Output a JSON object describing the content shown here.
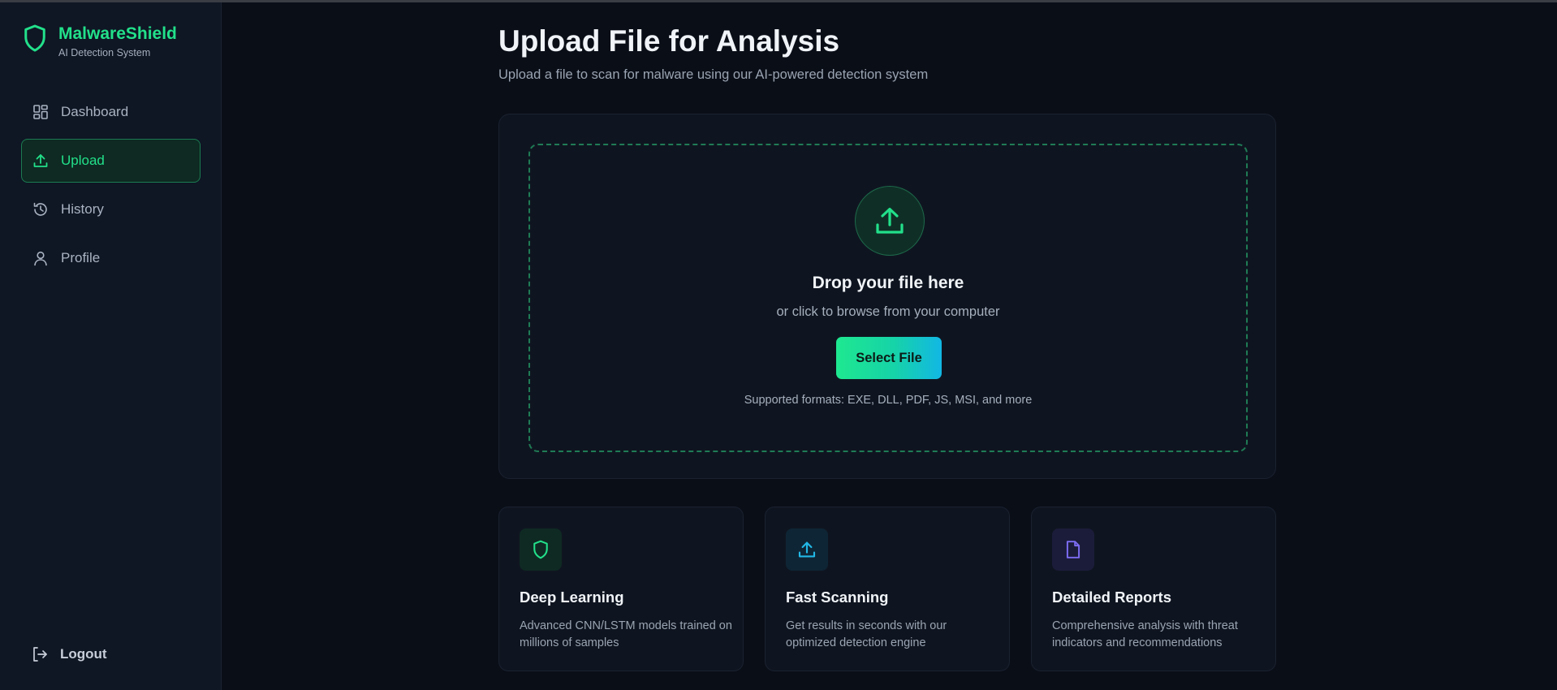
{
  "brand": {
    "title": "MalwareShield",
    "subtitle": "AI Detection System",
    "icon": "shield-icon"
  },
  "nav": {
    "items": [
      {
        "label": "Dashboard",
        "icon": "dashboard-icon",
        "active": false
      },
      {
        "label": "Upload",
        "icon": "upload-icon",
        "active": true
      },
      {
        "label": "History",
        "icon": "history-icon",
        "active": false
      },
      {
        "label": "Profile",
        "icon": "user-icon",
        "active": false
      }
    ],
    "logout": "Logout"
  },
  "page": {
    "title": "Upload File for Analysis",
    "subtitle": "Upload a file to scan for malware using our AI-powered detection system"
  },
  "dropzone": {
    "title": "Drop your file here",
    "subtitle": "or click to browse from your computer",
    "button": "Select File",
    "formats": "Supported formats: EXE, DLL, PDF, JS, MSI, and more"
  },
  "features": [
    {
      "title": "Deep Learning",
      "description": "Advanced CNN/LSTM models trained on millions of samples",
      "icon": "shield-icon",
      "color": "#22e08a"
    },
    {
      "title": "Fast Scanning",
      "description": "Get results in seconds with our optimized detection engine",
      "icon": "upload-icon",
      "color": "#22b8e6"
    },
    {
      "title": "Detailed Reports",
      "description": "Comprehensive analysis with threat indicators and recommendations",
      "icon": "document-icon",
      "color": "#7c6cf2"
    }
  ],
  "colors": {
    "accent": "#22e08a",
    "background": "#0a0e17",
    "sidebar": "#0f1624"
  }
}
